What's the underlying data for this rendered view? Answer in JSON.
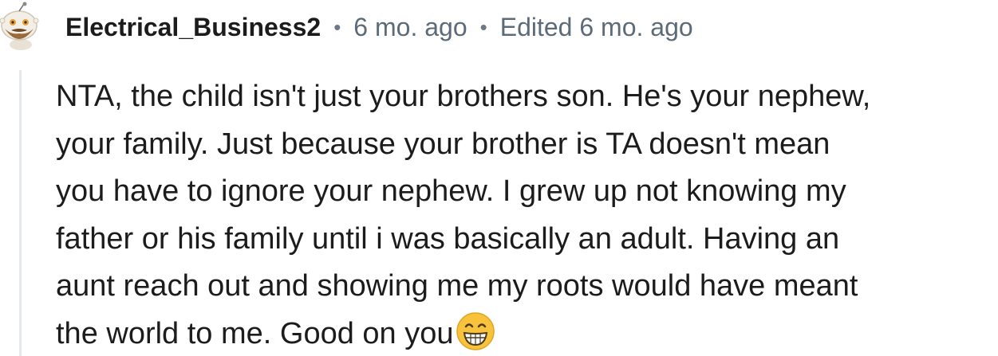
{
  "comment": {
    "username": "Electrical_Business2",
    "separator": "•",
    "time_ago": "6 mo. ago",
    "edited": "Edited 6 mo. ago",
    "body_lines": [
      "NTA, the child isn't just your brothers son. He's your nephew,",
      "your family. Just because your brother is TA doesn't mean",
      "you have to ignore your nephew. I grew up not knowing my",
      "father or his family until i was basically an adult. Having an",
      "aunt reach out and showing me my roots would have meant",
      "the world to me. Good on you"
    ],
    "emoji": "grinning-face-with-smiling-eyes"
  },
  "colors": {
    "username": "#1c1c1c",
    "meta": "#5d6b78",
    "body_text": "#1c1c1c",
    "thread_line": "#e6e9ec",
    "emoji_face": "#f9c23c"
  }
}
